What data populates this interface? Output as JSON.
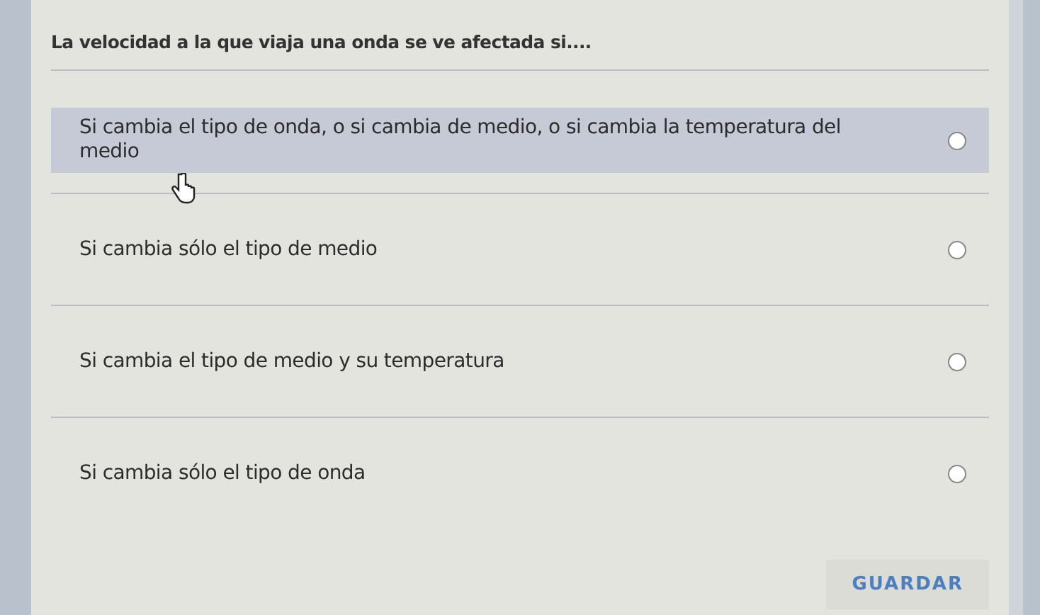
{
  "question": "La velocidad a la que viaja una onda se ve afectada si....",
  "options": [
    {
      "label": "Si cambia el tipo de onda, o si cambia de medio, o si cambia la temperatura del medio",
      "highlighted": true,
      "selected": false
    },
    {
      "label": "Si cambia sólo el tipo de medio",
      "highlighted": false,
      "selected": false
    },
    {
      "label": "Si cambia el tipo de medio y su temperatura",
      "highlighted": false,
      "selected": false
    },
    {
      "label": "Si cambia sólo el tipo de onda",
      "highlighted": false,
      "selected": false
    }
  ],
  "button": "GUARDAR"
}
